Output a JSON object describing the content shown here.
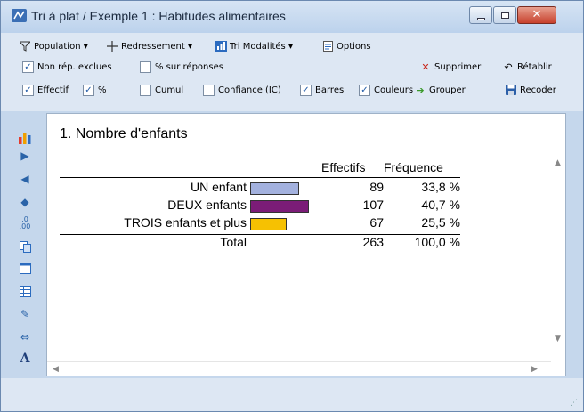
{
  "window": {
    "title": "Tri à plat / Exemple 1 : Habitudes alimentaires",
    "close_glyph": "✕"
  },
  "toolbar": {
    "population_label": "Population",
    "redressement_label": "Redressement",
    "tri_modalites_label": "Tri Modalités",
    "options_label": "Options",
    "supprimer_label": "Supprimer",
    "retablir_label": "Rétablir",
    "grouper_label": "Grouper",
    "recoder_label": "Recoder",
    "dropdown_glyph": "▾"
  },
  "checkboxes": [
    {
      "label": "Non rép. exclues",
      "checked": true
    },
    {
      "label": "% sur réponses",
      "checked": false
    },
    {
      "label": "Effectif",
      "checked": true
    },
    {
      "label": "%",
      "checked": true
    },
    {
      "label": "Cumul",
      "checked": false
    },
    {
      "label": "Confiance (IC)",
      "checked": false
    },
    {
      "label": "Barres",
      "checked": true
    },
    {
      "label": "Couleurs",
      "checked": true
    }
  ],
  "content": {
    "heading": "1. Nombre d'enfants",
    "col_effectifs": "Effectifs",
    "col_frequence": "Fréquence",
    "rows": [
      {
        "label": "UN enfant",
        "effectif": "89",
        "frequence": "33,8 %",
        "color": "#a3b1de",
        "value": 89
      },
      {
        "label": "DEUX enfants",
        "effectif": "107",
        "frequence": "40,7 %",
        "color": "#7b1c77",
        "value": 107
      },
      {
        "label": "TROIS enfants et plus",
        "effectif": "67",
        "frequence": "25,5 %",
        "color": "#f6c102",
        "value": 67
      }
    ],
    "total": {
      "label": "Total",
      "effectif": "263",
      "frequence": "100,0 %"
    }
  },
  "colors": {
    "accent": "#1f5aa6"
  }
}
